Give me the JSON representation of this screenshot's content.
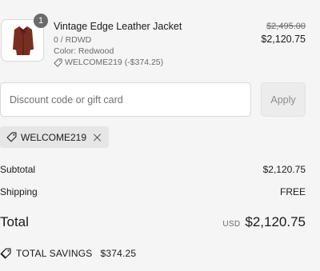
{
  "line_item": {
    "quantity": "1",
    "name": "Vintage Edge Leather Jacket",
    "variant": "0 / RDWD",
    "color": "Color: Redwood",
    "discount": "WELCOME219 (-$374.25)",
    "original_price": "$2,495.00",
    "price": "$2,120.75",
    "image_icon": "leather-jacket-image"
  },
  "discount": {
    "placeholder": "Discount code or gift card",
    "value": "",
    "apply_label": "Apply"
  },
  "applied_code": {
    "code": "WELCOME219",
    "icon": "tag-icon",
    "remove_icon": "close-icon"
  },
  "totals": {
    "subtotal_label": "Subtotal",
    "subtotal_value": "$2,120.75",
    "shipping_label": "Shipping",
    "shipping_value": "FREE",
    "total_label": "Total",
    "currency": "USD",
    "total_value": "$2,120.75",
    "savings_label": "TOTAL SAVINGS",
    "savings_value": "$374.25"
  },
  "colors": {
    "background": "#f5f5f5",
    "text": "#1a1a1a",
    "muted": "#6b6b6b",
    "badge": "#6b6b6b",
    "chip": "#e6e6e6",
    "jacket": "#7a2e22"
  }
}
